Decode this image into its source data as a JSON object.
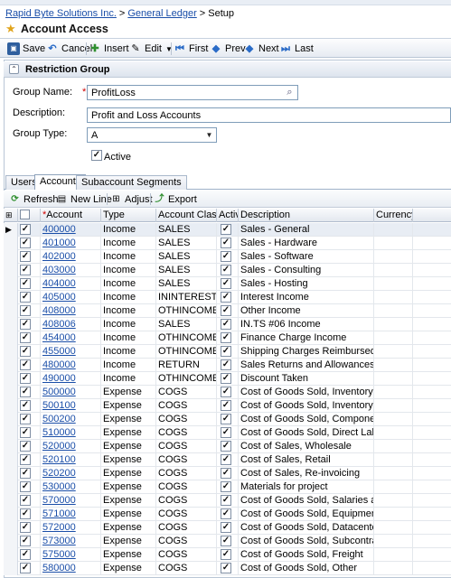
{
  "breadcrumb": {
    "company": "Rapid Byte Solutions Inc.",
    "module": "General Ledger",
    "section": "Setup",
    "separator": ">"
  },
  "screen_title": "Account Access",
  "toolbar": {
    "save": "Save",
    "cancel": "Cancel",
    "insert": "Insert",
    "edit": "Edit",
    "first": "First",
    "prev": "Prev",
    "next": "Next",
    "last": "Last"
  },
  "group": {
    "header": "Restriction Group",
    "name_label": "Group Name:",
    "name_value": "ProfitLoss",
    "description_label": "Description:",
    "description_value": "Profit and Loss Accounts",
    "type_label": "Group Type:",
    "type_value": "A",
    "active_label": "Active",
    "active_checked": true
  },
  "tabs": [
    "Users",
    "Accounts",
    "Subaccount Segments"
  ],
  "active_tab": "Accounts",
  "grid_toolbar": {
    "refresh": "Refresh",
    "new_line": "New Line",
    "adjust": "Adjust",
    "export": "Export"
  },
  "columns": {
    "account": "Account",
    "type": "Type",
    "account_class": "Account Class",
    "active": "Active",
    "description": "Description",
    "currency": "Currency"
  },
  "rows": [
    {
      "account": "400000",
      "type": "Income",
      "cls": "SALES",
      "desc": "Sales - General",
      "selected": true
    },
    {
      "account": "401000",
      "type": "Income",
      "cls": "SALES",
      "desc": "Sales - Hardware"
    },
    {
      "account": "402000",
      "type": "Income",
      "cls": "SALES",
      "desc": "Sales - Software"
    },
    {
      "account": "403000",
      "type": "Income",
      "cls": "SALES",
      "desc": "Sales - Consulting"
    },
    {
      "account": "404000",
      "type": "Income",
      "cls": "SALES",
      "desc": "Sales - Hosting"
    },
    {
      "account": "405000",
      "type": "Income",
      "cls": "ININTEREST",
      "desc": "Interest Income"
    },
    {
      "account": "408000",
      "type": "Income",
      "cls": "OTHINCOME",
      "desc": "Other Income"
    },
    {
      "account": "408006",
      "type": "Income",
      "cls": "SALES",
      "desc": "IN.TS #06 Income"
    },
    {
      "account": "454000",
      "type": "Income",
      "cls": "OTHINCOME",
      "desc": "Finance Charge Income"
    },
    {
      "account": "455000",
      "type": "Income",
      "cls": "OTHINCOME",
      "desc": "Shipping Charges Reimbursed"
    },
    {
      "account": "480000",
      "type": "Income",
      "cls": "RETURN",
      "desc": "Sales Returns and Allowances"
    },
    {
      "account": "490000",
      "type": "Income",
      "cls": "OTHINCOME",
      "desc": "Discount Taken"
    },
    {
      "account": "500000",
      "type": "Expense",
      "cls": "COGS",
      "desc": "Cost of Goods Sold, Inventory - Hardware"
    },
    {
      "account": "500100",
      "type": "Expense",
      "cls": "COGS",
      "desc": "Cost of Goods Sold, Inventory - Software"
    },
    {
      "account": "500200",
      "type": "Expense",
      "cls": "COGS",
      "desc": "Cost of Goods Sold, Components"
    },
    {
      "account": "510000",
      "type": "Expense",
      "cls": "COGS",
      "desc": "Cost of Goods Sold, Direct Labor Cost"
    },
    {
      "account": "520000",
      "type": "Expense",
      "cls": "COGS",
      "desc": "Cost of Sales, Wholesale"
    },
    {
      "account": "520100",
      "type": "Expense",
      "cls": "COGS",
      "desc": "Cost of Sales, Retail"
    },
    {
      "account": "520200",
      "type": "Expense",
      "cls": "COGS",
      "desc": "Cost of Sales, Re-invoicing"
    },
    {
      "account": "530000",
      "type": "Expense",
      "cls": "COGS",
      "desc": "Materials for project"
    },
    {
      "account": "570000",
      "type": "Expense",
      "cls": "COGS",
      "desc": "Cost of Goods Sold, Salaries and Wages"
    },
    {
      "account": "571000",
      "type": "Expense",
      "cls": "COGS",
      "desc": "Cost of Goods Sold, Equipment Rental"
    },
    {
      "account": "572000",
      "type": "Expense",
      "cls": "COGS",
      "desc": "Cost of Goods Sold, Datacenter Rent"
    },
    {
      "account": "573000",
      "type": "Expense",
      "cls": "COGS",
      "desc": "Cost of Goods Sold, Subcontractors"
    },
    {
      "account": "575000",
      "type": "Expense",
      "cls": "COGS",
      "desc": "Cost of Goods Sold, Freight"
    },
    {
      "account": "580000",
      "type": "Expense",
      "cls": "COGS",
      "desc": "Cost of Goods Sold, Other"
    }
  ],
  "colors": {
    "link": "#1a4ea8",
    "required": "#d00000",
    "toolbar_bg": "#e6ebf2",
    "selected_row": "#e8edf4"
  },
  "icons": {
    "save": "floppy-icon",
    "cancel": "undo-icon",
    "insert": "insert-icon",
    "edit": "edit-icon",
    "first": "first-icon",
    "prev": "prev-icon",
    "next": "next-icon",
    "last": "last-icon",
    "refresh": "refresh-icon",
    "new_line": "new-line-icon",
    "adjust": "adjust-icon",
    "export": "export-icon"
  }
}
